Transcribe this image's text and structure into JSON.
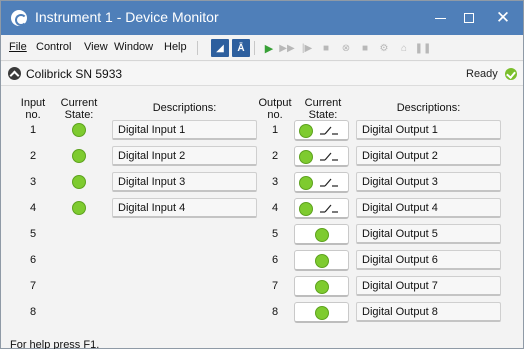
{
  "window": {
    "title": "Instrument 1 - Device Monitor",
    "controls": {
      "minimize": "—",
      "maximize": "☐",
      "close": "✕"
    }
  },
  "menu": {
    "items": [
      {
        "label": "File"
      },
      {
        "label": "Control"
      },
      {
        "label": "View"
      },
      {
        "label": "Window"
      },
      {
        "label": "Help"
      }
    ]
  },
  "toolbar": {
    "icons": [
      "measure-icon",
      "spectrum-icon",
      "play-icon",
      "fast-forward-icon",
      "step-icon",
      "camera-icon",
      "stop-circle-icon",
      "stop-icon",
      "settings-icon",
      "antenna-icon",
      "pause-icon"
    ]
  },
  "device": {
    "name": "Colibrick SN 5933",
    "status": "Ready",
    "status_color": "#7bbf2c"
  },
  "inputs": {
    "header_no": "Input no.",
    "header_state": "Current State:",
    "header_desc": "Descriptions:",
    "rows": [
      {
        "no": "1",
        "active": true,
        "description": "Digital Input 1"
      },
      {
        "no": "2",
        "active": true,
        "description": "Digital Input 2"
      },
      {
        "no": "3",
        "active": true,
        "description": "Digital Input 3"
      },
      {
        "no": "4",
        "active": true,
        "description": "Digital Input 4"
      },
      {
        "no": "5",
        "active": false,
        "description": ""
      },
      {
        "no": "6",
        "active": false,
        "description": ""
      },
      {
        "no": "7",
        "active": false,
        "description": ""
      },
      {
        "no": "8",
        "active": false,
        "description": ""
      }
    ]
  },
  "outputs": {
    "header_no": "Output no.",
    "header_state": "Current State:",
    "header_desc": "Descriptions:",
    "rows": [
      {
        "no": "1",
        "type": "switch",
        "description": "Digital Output 1"
      },
      {
        "no": "2",
        "type": "switch",
        "description": "Digital Output 2"
      },
      {
        "no": "3",
        "type": "switch",
        "description": "Digital Output 3"
      },
      {
        "no": "4",
        "type": "switch",
        "description": "Digital Output 4"
      },
      {
        "no": "5",
        "type": "led",
        "description": "Digital Output 5"
      },
      {
        "no": "6",
        "type": "led",
        "description": "Digital Output 6"
      },
      {
        "no": "7",
        "type": "led",
        "description": "Digital Output 7"
      },
      {
        "no": "8",
        "type": "led",
        "description": "Digital Output 8"
      }
    ]
  },
  "statusbar": {
    "text": "For help press F1."
  },
  "colors": {
    "titlebar": "#4f7fb9",
    "led_on": "#7ecb2f"
  }
}
